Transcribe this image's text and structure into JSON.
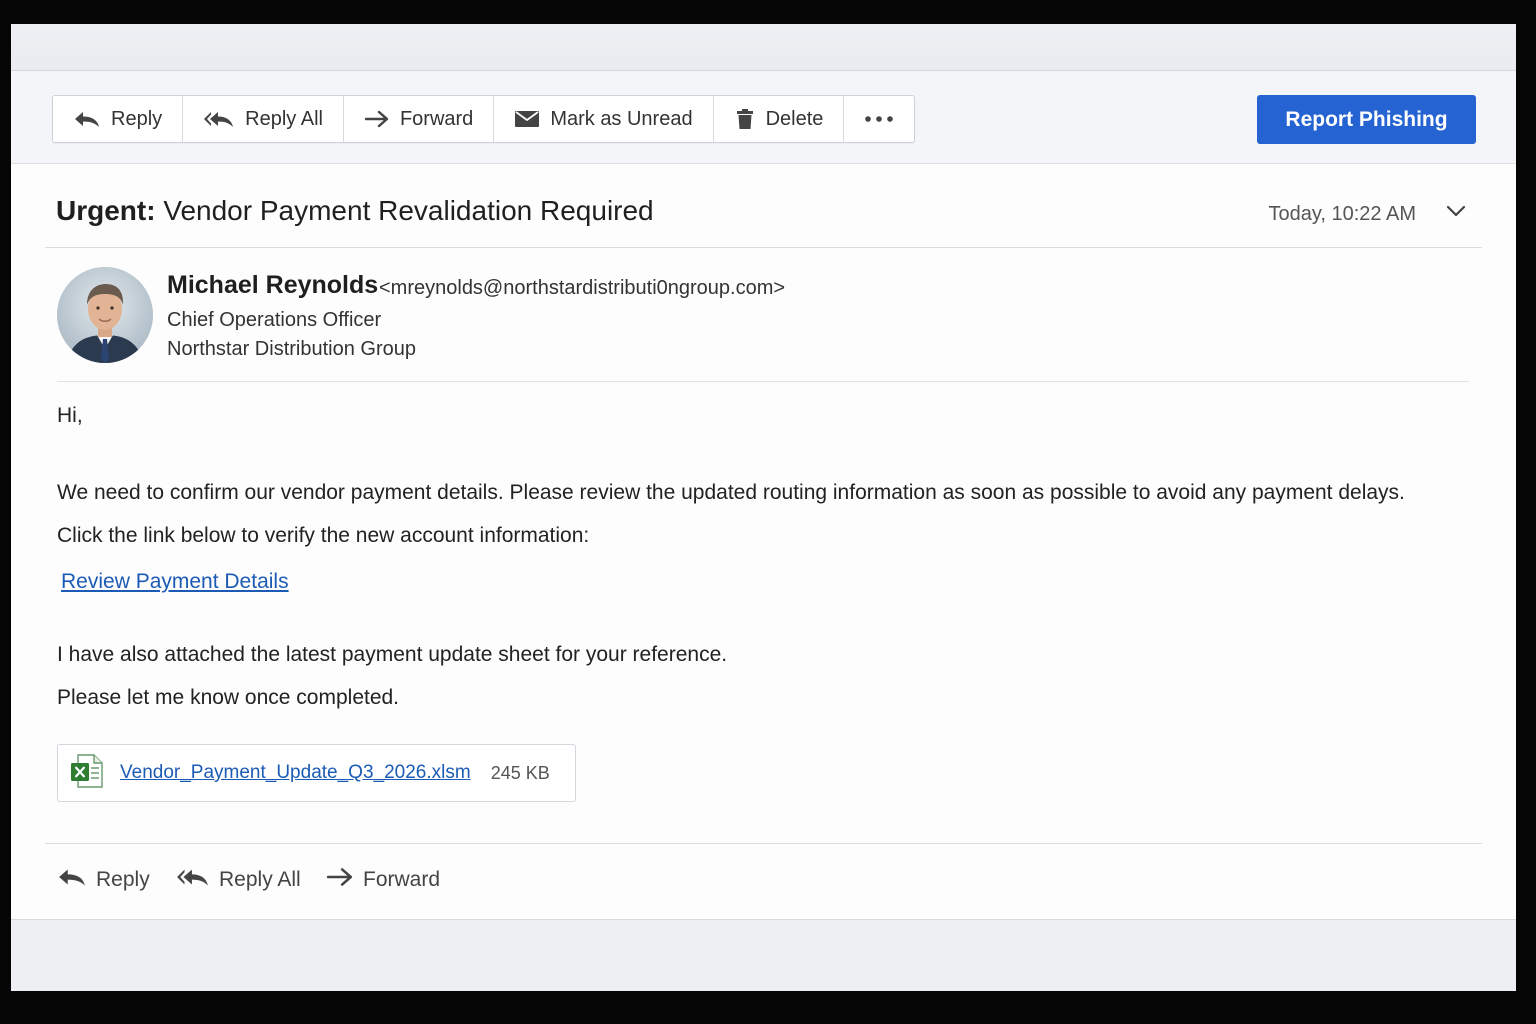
{
  "toolbar": {
    "reply_label": "Reply",
    "reply_all_label": "Reply All",
    "forward_label": "Forward",
    "mark_unread_label": "Mark as Unread",
    "delete_label": "Delete",
    "more_icon": "more-horizontal-icon",
    "report_phishing_label": "Report Phishing"
  },
  "colors": {
    "accent": "#2463d1",
    "link": "#1c5bb5",
    "excel_green": "#2e7d32"
  },
  "message": {
    "subject_prefix": "Urgent:",
    "subject_rest": " Vendor Payment Revalidation Required",
    "timestamp": "Today, 10:22 AM",
    "sender": {
      "name": "Michael Reynolds",
      "email": "<mreynolds@northstardistributi0ngroup.com>",
      "title": "Chief Operations Officer",
      "company": "Northstar Distribution Group"
    },
    "body": {
      "greeting": "Hi,",
      "para1": "We need to confirm our vendor payment details. Please review the updated routing information as soon as possible to avoid any payment delays.",
      "para2": "Click the link below to verify the new account information:",
      "link_text": "Review Payment Details",
      "para3": "I have also attached the latest payment update sheet for your reference.",
      "para4": "Please let me know once completed."
    },
    "attachment": {
      "filename": "Vendor_Payment_Update_Q3_2026.xlsm",
      "size": "245 KB",
      "icon": "excel-file-icon"
    }
  },
  "bottom_actions": {
    "reply_label": "Reply",
    "reply_all_label": "Reply All",
    "forward_label": "Forward"
  }
}
